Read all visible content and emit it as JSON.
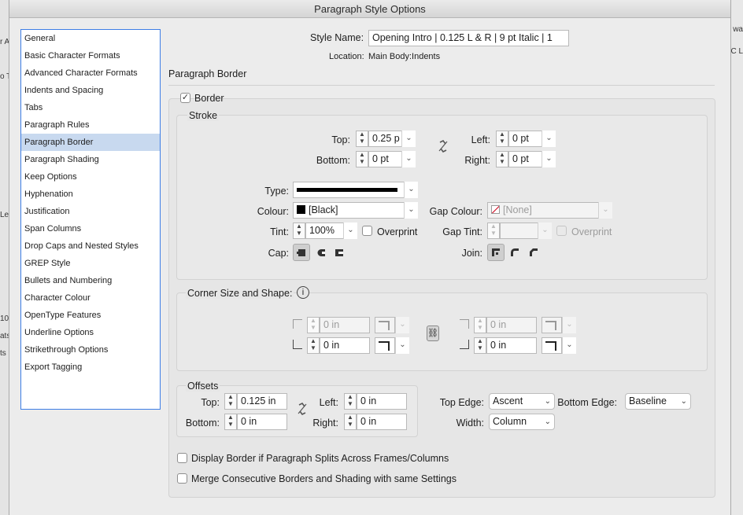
{
  "window": {
    "title": "Paragraph Style Options"
  },
  "background_fragments": {
    "left": [
      "r A",
      "o T",
      "Leg",
      "10",
      "ats",
      "ts"
    ],
    "right": [
      "wa",
      "C L"
    ]
  },
  "sidebar": {
    "items": [
      {
        "label": "General",
        "selected": false
      },
      {
        "label": "Basic Character Formats",
        "selected": false
      },
      {
        "label": "Advanced Character Formats",
        "selected": false
      },
      {
        "label": "Indents and Spacing",
        "selected": false
      },
      {
        "label": "Tabs",
        "selected": false
      },
      {
        "label": "Paragraph Rules",
        "selected": false
      },
      {
        "label": "Paragraph Border",
        "selected": true
      },
      {
        "label": "Paragraph Shading",
        "selected": false
      },
      {
        "label": "Keep Options",
        "selected": false
      },
      {
        "label": "Hyphenation",
        "selected": false
      },
      {
        "label": "Justification",
        "selected": false
      },
      {
        "label": "Span Columns",
        "selected": false
      },
      {
        "label": "Drop Caps and Nested Styles",
        "selected": false
      },
      {
        "label": "GREP Style",
        "selected": false
      },
      {
        "label": "Bullets and Numbering",
        "selected": false
      },
      {
        "label": "Character Colour",
        "selected": false
      },
      {
        "label": "OpenType Features",
        "selected": false
      },
      {
        "label": "Underline Options",
        "selected": false
      },
      {
        "label": "Strikethrough Options",
        "selected": false
      },
      {
        "label": "Export Tagging",
        "selected": false
      }
    ]
  },
  "header": {
    "style_name_label": "Style Name:",
    "style_name_value": "Opening Intro | 0.125 L & R | 9 pt Italic | 1",
    "location_label": "Location:",
    "location_value": "Main Body:Indents",
    "section_title": "Paragraph Border"
  },
  "border": {
    "checkbox_label": "Border",
    "checked": true
  },
  "stroke": {
    "title": "Stroke",
    "top_label": "Top:",
    "top_value": "0.25 p",
    "bottom_label": "Bottom:",
    "bottom_value": "0 pt",
    "left_label": "Left:",
    "left_value": "0 pt",
    "right_label": "Right:",
    "right_value": "0 pt",
    "type_label": "Type:",
    "colour_label": "Colour:",
    "colour_value": "[Black]",
    "gap_colour_label": "Gap Colour:",
    "gap_colour_value": "[None]",
    "tint_label": "Tint:",
    "tint_value": "100%",
    "overprint_label": "Overprint",
    "gap_tint_label": "Gap Tint:",
    "gap_overprint_label": "Overprint",
    "cap_label": "Cap:",
    "join_label": "Join:",
    "colors": {
      "black": "#000000",
      "none_slash": "#d0021b"
    }
  },
  "corner": {
    "title": "Corner Size and Shape:",
    "top_left_value": "0 in",
    "bottom_left_value": "0 in",
    "top_right_value": "0 in",
    "bottom_right_value": "0 in"
  },
  "offsets": {
    "title": "Offsets",
    "top_label": "Top:",
    "top_value": "0.125 in",
    "bottom_label": "Bottom:",
    "bottom_value": "0 in",
    "left_label": "Left:",
    "left_value": "0 in",
    "right_label": "Right:",
    "right_value": "0 in",
    "top_edge_label": "Top Edge:",
    "top_edge_value": "Ascent",
    "bottom_edge_label": "Bottom Edge:",
    "bottom_edge_value": "Baseline",
    "width_label": "Width:",
    "width_value": "Column"
  },
  "options": {
    "display_split_label": "Display Border if Paragraph Splits Across Frames/Columns",
    "merge_label": "Merge Consecutive Borders and Shading with same Settings"
  }
}
